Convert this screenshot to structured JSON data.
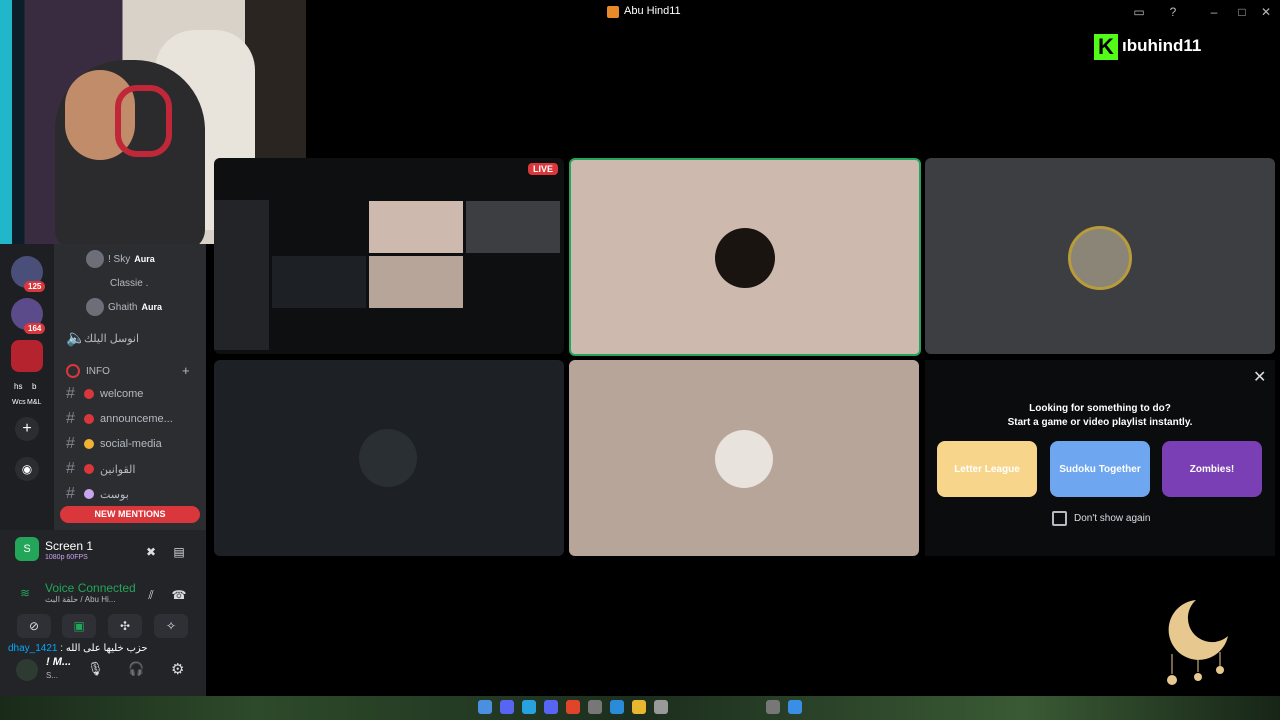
{
  "window": {
    "title": "Abu Hind11"
  },
  "branding": {
    "kick_letter": "K",
    "channel_name": "ıbuhind11"
  },
  "servers": {
    "badges": [
      "125",
      "164"
    ],
    "labels": [
      "hs",
      "b",
      "Wcs",
      "M&L"
    ]
  },
  "members": [
    {
      "name": "! Sky",
      "tag": "Aura"
    },
    {
      "name": "Classie .",
      "tag": ""
    },
    {
      "name": "Ghaith",
      "tag": "Aura"
    }
  ],
  "voice_room": {
    "label": "انوسل اليلك"
  },
  "category": {
    "label": "INFO"
  },
  "channels": [
    {
      "name": "welcome",
      "color": "#da373c"
    },
    {
      "name": "announceme...",
      "color": "#da373c"
    },
    {
      "name": "social-media",
      "color": "#f0b232"
    },
    {
      "name": "القوانين",
      "color": "#da373c"
    },
    {
      "name": "بوست",
      "color": "#c9a5f0"
    }
  ],
  "new_mentions": "NEW MENTIONS",
  "stream_panel": {
    "name": "Screen 1",
    "quality": "1080p 60FPS"
  },
  "voice": {
    "status": "Voice Connected",
    "channel": "حلقة البث / Abu Hi..."
  },
  "chat": {
    "user": "dhay_1421",
    "message": ": حزب خليها على الله"
  },
  "me": {
    "name": "! M...",
    "status": "S..."
  },
  "live_badge": "LIVE",
  "activity": {
    "title_line1": "Looking for something to do?",
    "title_line2": "Start a game or video playlist instantly.",
    "games": [
      {
        "name": "Letter League",
        "color": "#f7d68c"
      },
      {
        "name": "Sudoku Together",
        "color": "#6fa6f0"
      },
      {
        "name": "Zombies!",
        "color": "#7b3fb5"
      }
    ],
    "dont_show": "Don't show again"
  },
  "icons": [
    "minimize-icon",
    "maximize-icon",
    "close-icon",
    "help-icon",
    "inbox-icon",
    "crescent-moon-icon"
  ]
}
